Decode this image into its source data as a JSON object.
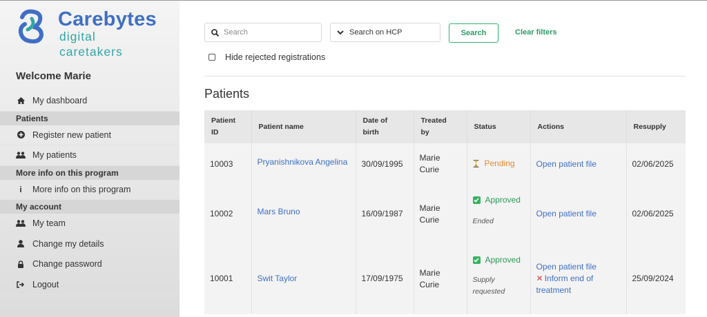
{
  "brand": {
    "name": "Carebytes",
    "tagline": "digital caretakers"
  },
  "sidebar": {
    "welcome": "Welcome Marie",
    "dashboard": {
      "label": "My dashboard",
      "icon": "home-icon"
    },
    "sections": {
      "patients": "Patients",
      "more_info": "More info on this program",
      "account": "My account"
    },
    "items": {
      "register": {
        "label": "Register new patient",
        "icon": "plus-circle-icon"
      },
      "my_patients": {
        "label": "My patients",
        "icon": "users-icon"
      },
      "more_info": {
        "label": "More info on this program",
        "icon": "info-icon"
      },
      "my_team": {
        "label": "My team",
        "icon": "users-icon"
      },
      "change_details": {
        "label": "Change my details",
        "icon": "user-icon"
      },
      "change_password": {
        "label": "Change password",
        "icon": "lock-icon"
      },
      "logout": {
        "label": "Logout",
        "icon": "logout-icon"
      }
    }
  },
  "filters": {
    "search_placeholder": "Search",
    "hcp_select": "Search on HCP",
    "search_button": "Search",
    "clear_filters": "Clear filters",
    "hide_rejected": "Hide rejected registrations",
    "hide_rejected_checked": false
  },
  "patients": {
    "title": "Patients",
    "columns": [
      "Patient ID",
      "Patient name",
      "Date of birth",
      "Treated by",
      "Status",
      "Actions",
      "Resupply"
    ],
    "rows": [
      {
        "id": "10003",
        "name": "Pryanishnikova Angelina",
        "dob": "30/09/1995",
        "treated_by": "Marie Curie",
        "status": "Pending",
        "status_type": "pending",
        "status_note": "",
        "action_open": "Open patient file",
        "action_inform": "",
        "resupply": "02/06/2025"
      },
      {
        "id": "10002",
        "name": "Mars Bruno",
        "dob": "16/09/1987",
        "treated_by": "Marie Curie",
        "status": "Approved",
        "status_type": "approved",
        "status_note": "Ended",
        "action_open": "Open patient file",
        "action_inform": "",
        "resupply": "02/06/2025"
      },
      {
        "id": "10001",
        "name": "Swit Taylor",
        "dob": "17/09/1975",
        "treated_by": "Marie Curie",
        "status": "Approved",
        "status_type": "approved",
        "status_note": "Supply requested",
        "action_open": "Open patient file",
        "action_inform": "Inform end of treatment",
        "resupply": "25/09/2024"
      }
    ]
  },
  "colors": {
    "brand_blue": "#3f6fc5",
    "brand_teal": "#33a6a6",
    "accent_green": "#2b9b66",
    "pending_orange": "#e98a2e"
  }
}
